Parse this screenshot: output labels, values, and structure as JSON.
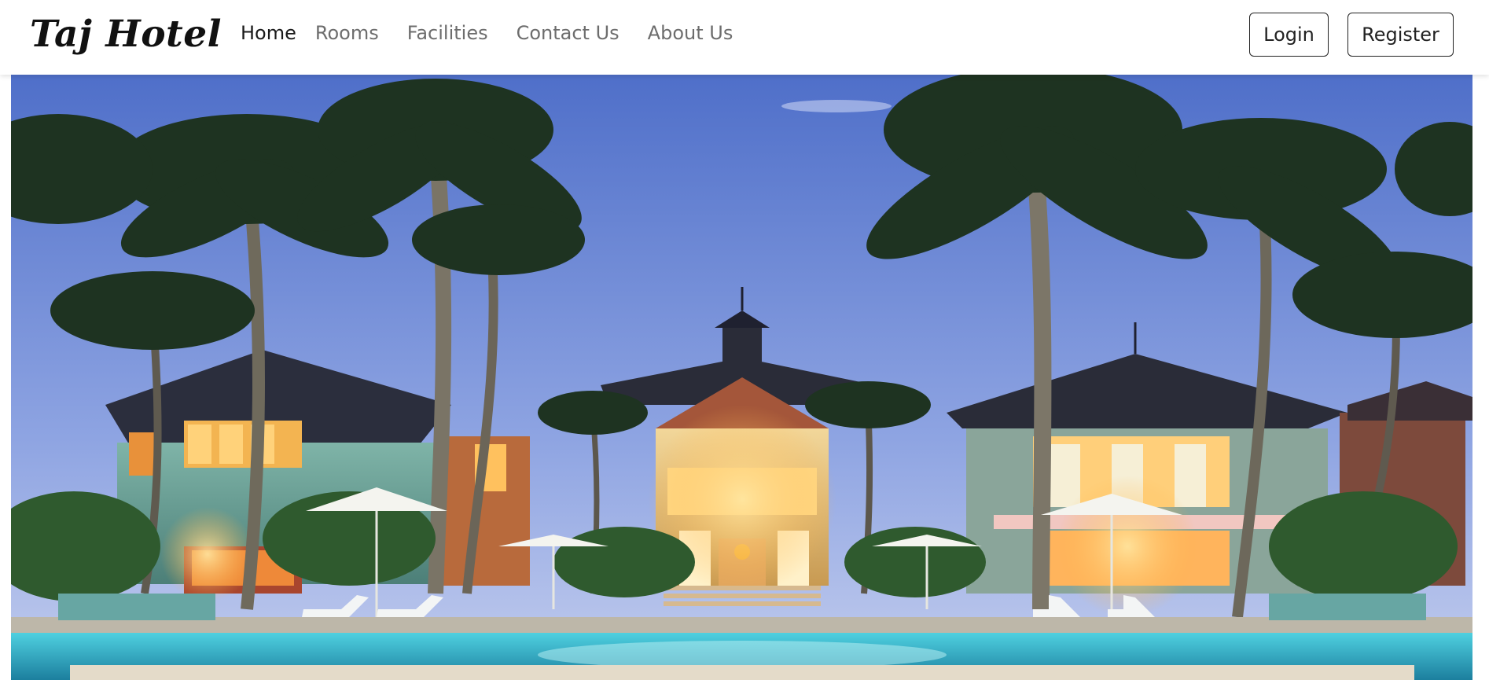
{
  "brand": {
    "name": "Taj Hotel"
  },
  "nav": {
    "links": [
      {
        "label": "Home",
        "active": true
      },
      {
        "label": "Rooms",
        "active": false
      },
      {
        "label": "Facilities",
        "active": false
      },
      {
        "label": "Contact Us",
        "active": false
      },
      {
        "label": "About Us",
        "active": false
      }
    ]
  },
  "auth": {
    "login_label": "Login",
    "register_label": "Register"
  },
  "hero": {
    "image_subject": "tropical-resort-hotel-at-dusk"
  },
  "colors": {
    "nav_text": "#6d6d6d",
    "nav_active": "#1a1a1a",
    "button_border": "#222222",
    "strip": "#e4dbc9",
    "sky_top": "#5a7ad0",
    "sky_bottom": "#bcc8ee",
    "pool": "#2fb6d0"
  }
}
